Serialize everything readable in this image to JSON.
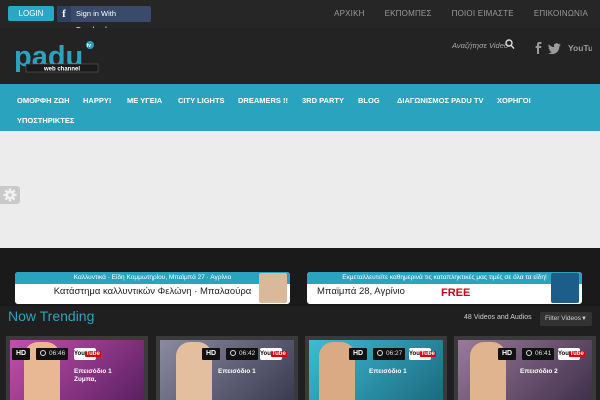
{
  "topbar": {
    "login_label": "LOGIN",
    "facebook_label": "Sign in With Facebook",
    "facebook_glyph": "f",
    "nav": [
      "ΑΡΧΙΚΗ",
      "ΕΚΠΟΜΠΕΣ",
      "ΠΟΙΟΙ ΕΙΜΑΣΤΕ",
      "ΕΠΙΚΟΙΝΩΝΙΑ"
    ]
  },
  "header": {
    "logo_text": "padu",
    "logo_tagline": "web channel",
    "logo_badge": "tv",
    "search_placeholder": "Αναζήτησε Video",
    "social_icons": [
      "facebook-icon",
      "twitter-icon",
      "youtube-icon"
    ],
    "youtube_label": "YouTube"
  },
  "mainnav": {
    "items": [
      "ΟΜΟΡΦΗ ΖΩΗ",
      "HAPPY!",
      "ΜΕ ΥΓΕΙΑ",
      "CITY LIGHTS",
      "DREAMERS !!",
      "3RD PARTY",
      "BLOG",
      "ΔΙΑΓΩΝΙΣΜΟΣ PADU TV",
      "ΧΟΡΗΓΟΙ",
      "ΥΠΟΣΤΗΡΙΚΤΕΣ"
    ]
  },
  "banners": [
    {
      "strip": "Καλλυντικά · Είδη Κομμωτηρίου, Μπαϊμπά 27 · Αγρίνιο",
      "title": "Κατάστημα καλλυντικών Φελώνη · Μπαλαούρα"
    },
    {
      "strip": "Εκμεταλλευτείτε καθημερινά τις καταπληκτικές μας τιμές σε όλα τα είδη!",
      "title": "Μπαϊμπά 28, Αγρίνιο",
      "badge": "FREE"
    }
  ],
  "trending": {
    "title": "Now Trending",
    "count": "48 Videos and Audios",
    "filter_label": "Filter Videos"
  },
  "cards": [
    {
      "hd": "HD",
      "duration": "06:46",
      "yt": "You",
      "yt_tube": "Tube",
      "episode": "Επεισόδιο 1",
      "sub": "Ζυμπα,",
      "theme": "#b33aa0"
    },
    {
      "hd": "HD",
      "duration": "06:42",
      "yt": "You",
      "yt_tube": "Tube",
      "episode": "Επεισόδιο 1",
      "sub": "",
      "theme": "#6a6a8a"
    },
    {
      "hd": "HD",
      "duration": "06:27",
      "yt": "You",
      "yt_tube": "Tube",
      "episode": "Επεισόδιο 1",
      "sub": "",
      "theme": "#2aa4be"
    },
    {
      "hd": "HD",
      "duration": "06:41",
      "yt": "You",
      "yt_tube": "Tube",
      "episode": "Επεισόδιο 2",
      "sub": "",
      "theme": "#7a5a7a"
    }
  ],
  "colors": {
    "accent": "#2aa4be",
    "header_bg": "#232323",
    "topbar_bg": "#262626"
  }
}
